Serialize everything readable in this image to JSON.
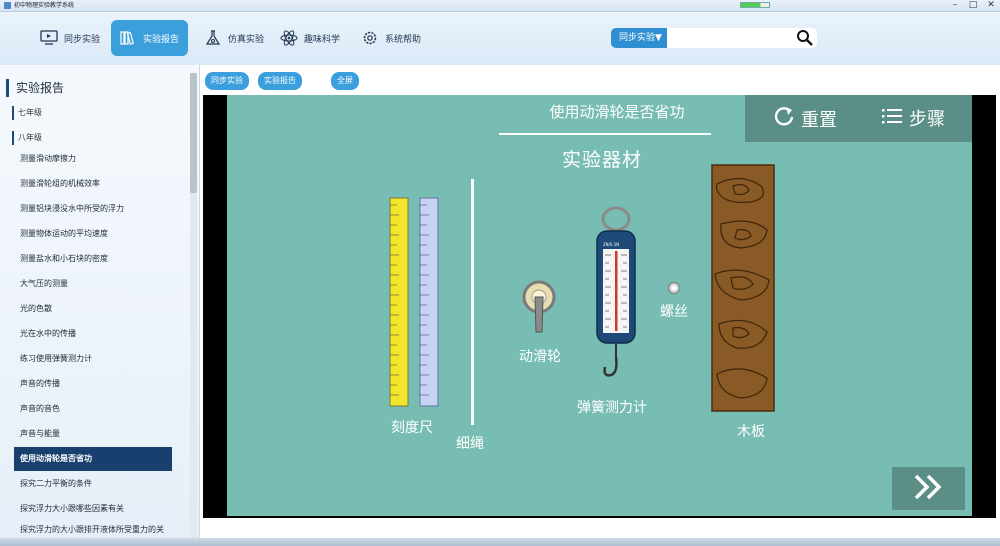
{
  "window": {
    "title": "初中物理实验教学系统"
  },
  "nav": {
    "items": [
      {
        "label": "同步实验",
        "icon": "monitor-icon"
      },
      {
        "label": "实验报告",
        "icon": "books-icon"
      },
      {
        "label": "仿真实验",
        "icon": "flask-icon"
      },
      {
        "label": "趣味科学",
        "icon": "atom-icon"
      },
      {
        "label": "系统帮助",
        "icon": "gear-icon"
      }
    ],
    "active_index": 1
  },
  "search": {
    "category": "同步实验▼",
    "placeholder": "",
    "value": ""
  },
  "sidebar": {
    "heading": "实验报告",
    "grades": [
      "七年级",
      "八年级"
    ],
    "items": [
      "测量滑动摩擦力",
      "测量滑轮组的机械效率",
      "测量铝块浸没水中所受的浮力",
      "测量物体运动的平均速度",
      "测量盐水和小石块的密度",
      "大气压的测量",
      "光的色散",
      "光在水中的传播",
      "练习使用弹簧测力计",
      "声音的传播",
      "声音的音色",
      "声音与能量",
      "使用动滑轮是否省功",
      "探究二力平衡的条件",
      "探究浮力大小跟哪些因素有关",
      "探究浮力的大小跟排开液体所受重力的关"
    ],
    "active_item": "使用动滑轮是否省功"
  },
  "tabs": [
    "同步实验",
    "实验报告",
    "全屏"
  ],
  "stage": {
    "title": "使用动滑轮是否省功",
    "reset_label": "重置",
    "steps_label": "步骤",
    "section_title": "实验器材",
    "equipment": {
      "ruler": "刻度尺",
      "rope": "细绳",
      "pulley": "动滑轮",
      "spring_scale": "弹簧测力计",
      "screw": "螺丝",
      "board": "木板"
    },
    "scale_unit_text": "N   g/f"
  },
  "colors": {
    "nav_active": "#3b9fdc",
    "stage_bg": "#78bdb3",
    "control_bg": "#5a8e86",
    "sidebar_active": "#17406e",
    "board": "#8a5a26"
  }
}
